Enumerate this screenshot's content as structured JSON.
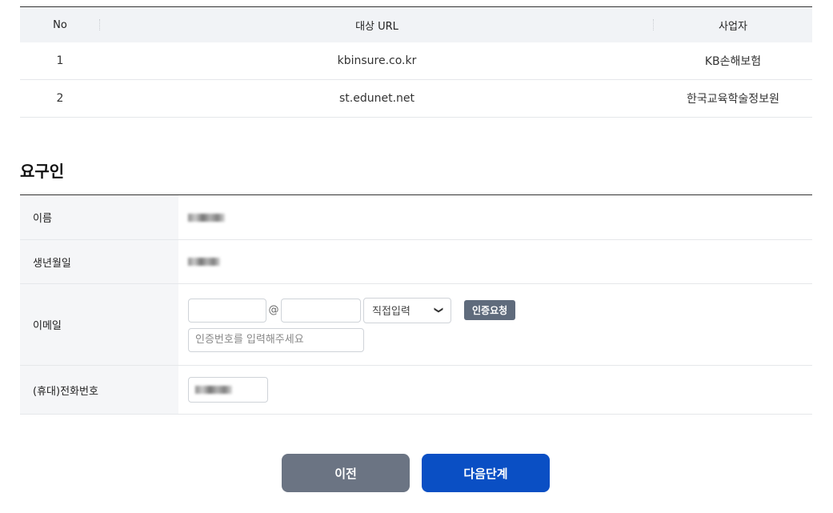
{
  "url_table": {
    "headers": {
      "no": "No",
      "url": "대상 URL",
      "operator": "사업자"
    },
    "rows": [
      {
        "no": "1",
        "url": "kbinsure.co.kr",
        "operator": "KB손해보험"
      },
      {
        "no": "2",
        "url": "st.edunet.net",
        "operator": "한국교육학술정보원"
      }
    ]
  },
  "requester": {
    "title": "요구인",
    "name_label": "이름",
    "birth_label": "생년월일",
    "email_label": "이메일",
    "email_at": "@",
    "email_select_value": "직접입력",
    "cert_button": "인증요청",
    "code_placeholder": "인증번호를 입력해주세요",
    "phone_label": "(휴대)전화번호"
  },
  "buttons": {
    "prev": "이전",
    "next": "다음단계"
  }
}
